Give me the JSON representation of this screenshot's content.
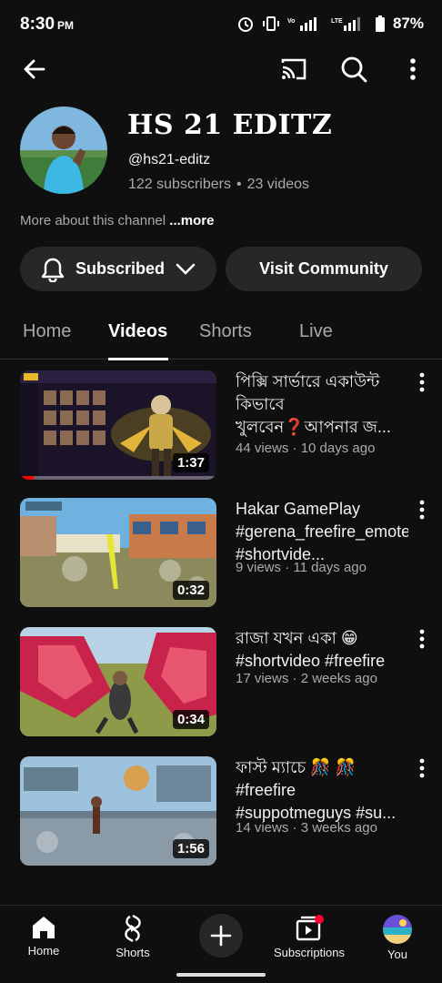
{
  "status_bar": {
    "time": "8:30",
    "ampm": "PM",
    "battery": "87%"
  },
  "channel": {
    "name": "HS 21 EDITZ",
    "handle": "@hs21-editz",
    "subscribers": "122 subscribers",
    "videos_count": "23 videos",
    "about": "More about this channel",
    "about_more": "...more"
  },
  "buttons": {
    "subscribed": "Subscribed",
    "community": "Visit Community"
  },
  "tabs": [
    {
      "label": "Home"
    },
    {
      "label": "Videos",
      "active": true
    },
    {
      "label": "Shorts"
    },
    {
      "label": "Live"
    }
  ],
  "videos": [
    {
      "title": "পিক্সি সার্ভারে একাউন্ট কিভাবে খুলবেন❓আপনার জ...",
      "meta": "44 views · 10 days ago",
      "duration": "1:37",
      "progress": 0.07
    },
    {
      "title": "Hakar GamePlay #gerena_freefire_emote_dance #shortvide...",
      "meta": "9 views · 11 days ago",
      "duration": "0:32"
    },
    {
      "title": "রাজা যখন একা 😁 #shortvideo #freefire",
      "meta": "17 views · 2 weeks ago",
      "duration": "0:34"
    },
    {
      "title": "ফাস্ট ম্যাচে 🎊 🎊#freefire #suppotmeguys #su...",
      "meta": "14 views · 3 weeks ago",
      "duration": "1:56"
    }
  ],
  "bottom_nav": {
    "home": "Home",
    "shorts": "Shorts",
    "subscriptions": "Subscriptions",
    "you": "You"
  },
  "colors": {
    "background": "#0f0f0f",
    "pill": "#272727",
    "accent_red": "#ff0000",
    "secondary_text": "#aaaaaa"
  }
}
